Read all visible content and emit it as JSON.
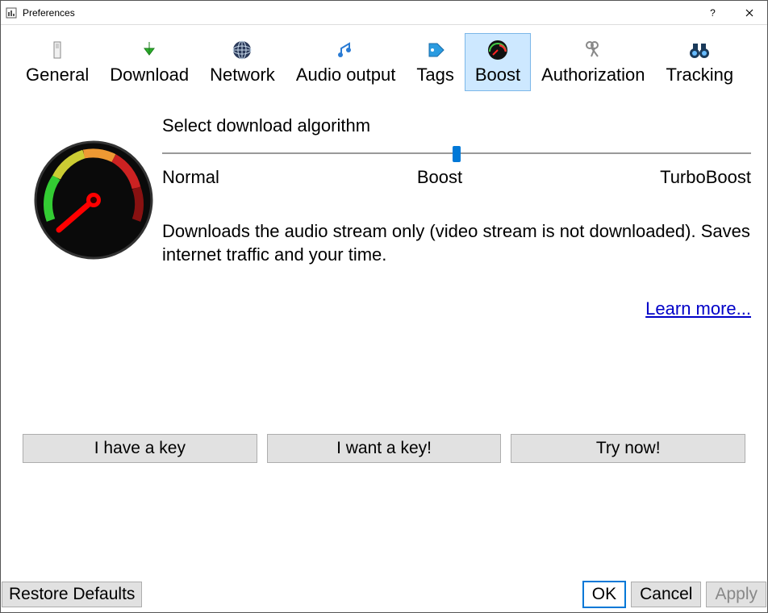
{
  "window": {
    "title": "Preferences"
  },
  "tabs": [
    {
      "label": "General"
    },
    {
      "label": "Download"
    },
    {
      "label": "Network"
    },
    {
      "label": "Audio output"
    },
    {
      "label": "Tags"
    },
    {
      "label": "Boost"
    },
    {
      "label": "Authorization"
    },
    {
      "label": "Tracking"
    }
  ],
  "boost": {
    "heading": "Select download algorithm",
    "slider": {
      "left": "Normal",
      "mid": "Boost",
      "right": "TurboBoost"
    },
    "description": "Downloads the audio stream only (video stream is not downloaded). Saves internet traffic and your time.",
    "learn_more": "Learn more..."
  },
  "keys": {
    "have": "I have a key",
    "want": "I want a key!",
    "try": "Try now!"
  },
  "footer": {
    "restore": "Restore Defaults",
    "ok": "OK",
    "cancel": "Cancel",
    "apply": "Apply"
  }
}
